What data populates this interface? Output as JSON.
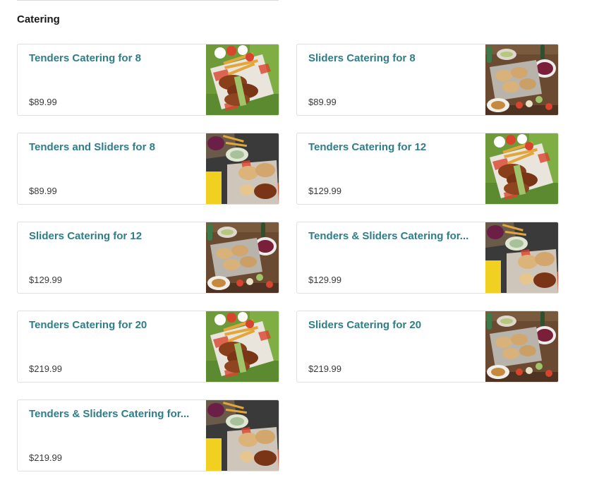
{
  "section": {
    "title": "Catering"
  },
  "items": [
    {
      "name": "Tenders Catering for 8",
      "price": "$89.99",
      "image": "tenders-platter-icon"
    },
    {
      "name": "Sliders Catering for 8",
      "price": "$89.99",
      "image": "sliders-platter-icon"
    },
    {
      "name": "Tenders and Sliders for 8",
      "price": "$89.99",
      "image": "tenders-sliders-platter-icon"
    },
    {
      "name": "Tenders Catering for 12",
      "price": "$129.99",
      "image": "tenders-platter-icon"
    },
    {
      "name": "Sliders Catering for 12",
      "price": "$129.99",
      "image": "sliders-platter-icon"
    },
    {
      "name": "Tenders & Sliders Catering for...",
      "price": "$129.99",
      "image": "tenders-sliders-platter-icon"
    },
    {
      "name": "Tenders Catering for 20",
      "price": "$219.99",
      "image": "tenders-platter-icon"
    },
    {
      "name": "Sliders Catering for 20",
      "price": "$219.99",
      "image": "sliders-platter-icon"
    },
    {
      "name": "Tenders & Sliders Catering for...",
      "price": "$219.99",
      "image": "tenders-sliders-platter-icon"
    }
  ],
  "colors": {
    "title": "#2f7d86",
    "price": "#3a3a3a",
    "border": "#e0e0e0",
    "heading": "#191919"
  }
}
